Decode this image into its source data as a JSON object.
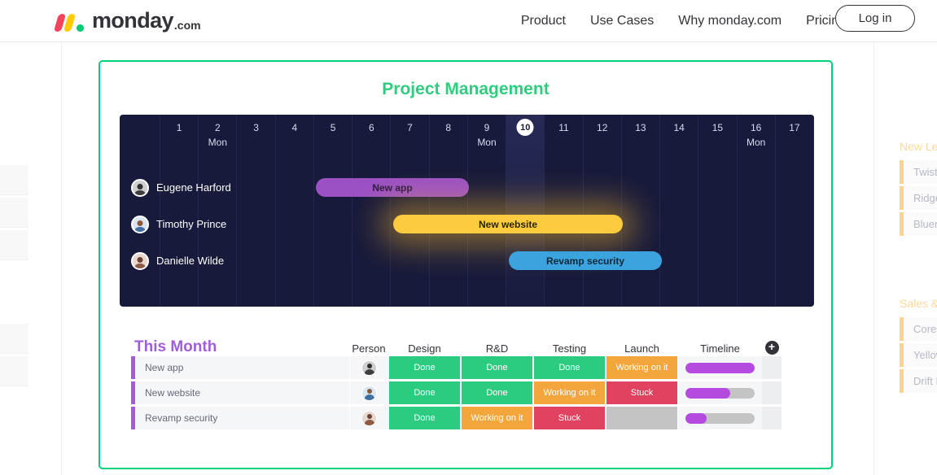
{
  "nav": {
    "logo_text": "monday",
    "logo_suffix": ".com",
    "links": [
      {
        "label": "Product"
      },
      {
        "label": "Use Cases"
      },
      {
        "label": "Why monday.com"
      },
      {
        "label": "Pricing"
      }
    ],
    "login_label": "Log in"
  },
  "card": {
    "title": "Project Management",
    "border_color": "#00d17a",
    "title_color": "#2fcd7f"
  },
  "gantt": {
    "background": "#181a3b",
    "days": [
      {
        "num": "1",
        "name": "",
        "today": false
      },
      {
        "num": "2",
        "name": "Mon",
        "today": false
      },
      {
        "num": "3",
        "name": "",
        "today": false
      },
      {
        "num": "4",
        "name": "",
        "today": false
      },
      {
        "num": "5",
        "name": "",
        "today": false
      },
      {
        "num": "6",
        "name": "",
        "today": false
      },
      {
        "num": "7",
        "name": "",
        "today": false
      },
      {
        "num": "8",
        "name": "",
        "today": false
      },
      {
        "num": "9",
        "name": "Mon",
        "today": false
      },
      {
        "num": "10",
        "name": "",
        "today": true
      },
      {
        "num": "11",
        "name": "",
        "today": false
      },
      {
        "num": "12",
        "name": "",
        "today": false
      },
      {
        "num": "13",
        "name": "",
        "today": false
      },
      {
        "num": "14",
        "name": "",
        "today": false
      },
      {
        "num": "15",
        "name": "",
        "today": false
      },
      {
        "num": "16",
        "name": "Mon",
        "today": false
      },
      {
        "num": "17",
        "name": "",
        "today": false
      }
    ],
    "rows": [
      {
        "person": "Eugene Harford",
        "task": "New app",
        "color": "#9b51c4"
      },
      {
        "person": "Timothy Prince",
        "task": "New website",
        "color": "#fdcb3e"
      },
      {
        "person": "Danielle Wilde",
        "task": "Revamp security",
        "color": "#3ba3dd"
      }
    ]
  },
  "table": {
    "section_title": "This Month",
    "section_title_color": "#a25ddc",
    "columns": {
      "person": "Person",
      "design": "Design",
      "rnd": "R&D",
      "testing": "Testing",
      "launch": "Launch",
      "timeline": "Timeline"
    },
    "add_label": "+",
    "rows": [
      {
        "name": "New app",
        "design": "Done",
        "rnd": "Done",
        "testing": "Done",
        "launch": "Working on it",
        "progress": 100
      },
      {
        "name": "New website",
        "design": "Done",
        "rnd": "Done",
        "testing": "Working on it",
        "launch": "Stuck",
        "progress": 65
      },
      {
        "name": "Revamp security",
        "design": "Done",
        "rnd": "Working on it",
        "testing": "Stuck",
        "launch": "",
        "progress": 30
      }
    ]
  },
  "background": {
    "boards": [
      {
        "title": "New Leads",
        "rows": [
          "Twisted",
          "Ridgeway",
          "Bluenote"
        ]
      },
      {
        "title": "Sales & Marketing",
        "rows": [
          "Corestone",
          "Yellowtail",
          "Drift Lane"
        ]
      }
    ]
  }
}
